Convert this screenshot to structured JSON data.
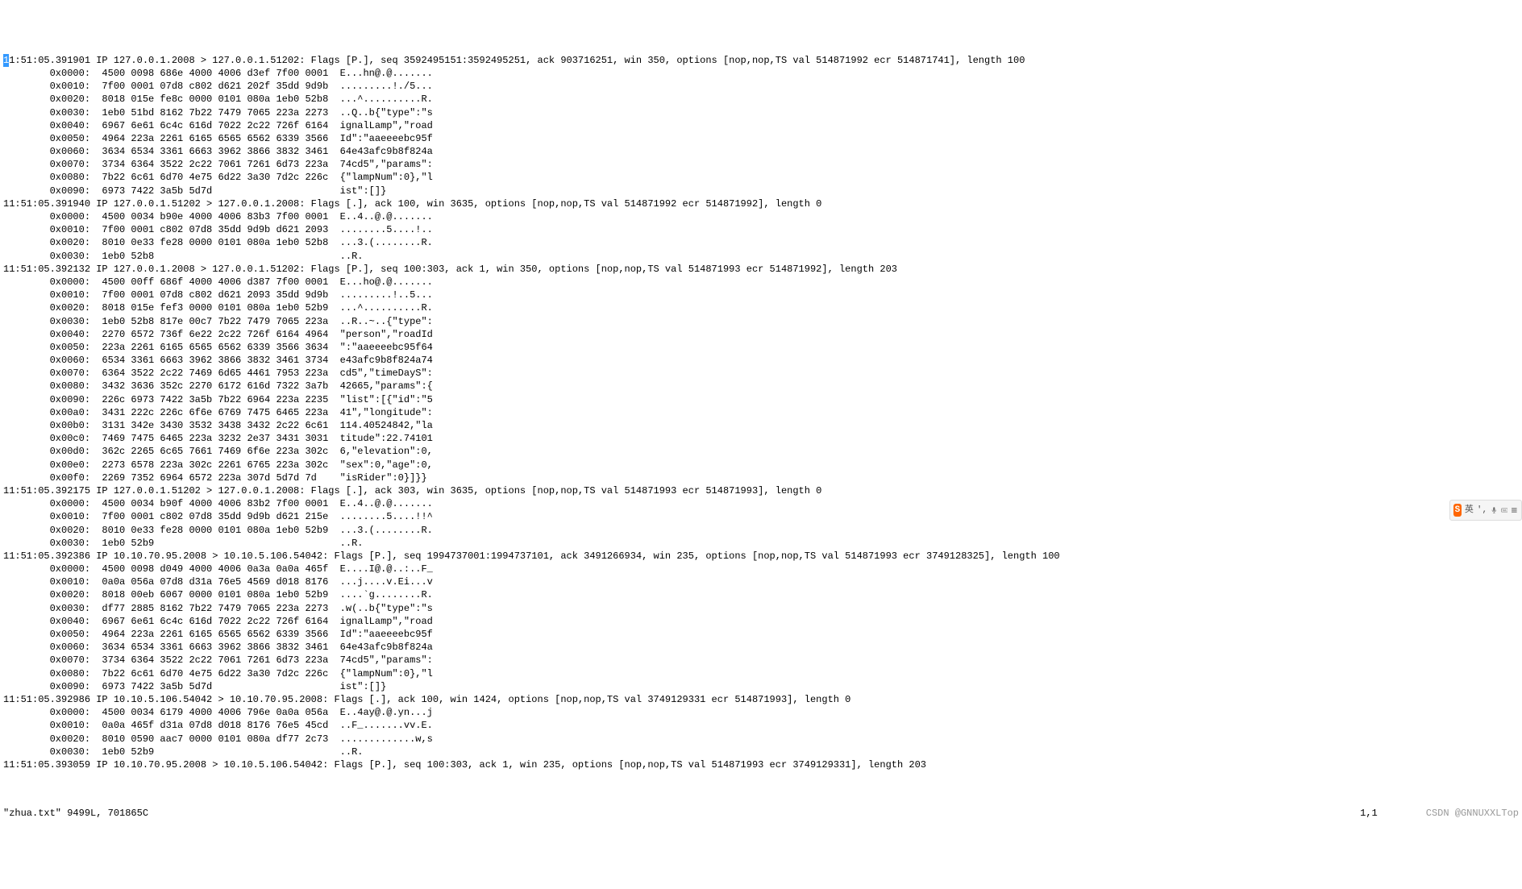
{
  "vim": {
    "cursor_char": "1",
    "status_file": "\"zhua.txt\" 9499L, 701865C",
    "status_pos": "1,1",
    "status_mode": "Top",
    "watermark": "CSDN @GNNUXXL"
  },
  "ime": {
    "logo": "S",
    "lang": "英",
    "sep": "',"
  },
  "packets": [
    {
      "header": "1:51:05.391901 IP 127.0.0.1.2008 > 127.0.0.1.51202: Flags [P.], seq 3592495151:3592495251, ack 903716251, win 350, options [nop,nop,TS val 514871992 ecr 514871741], length 100",
      "cursor_prefix": true,
      "hex": [
        "        0x0000:  4500 0098 686e 4000 4006 d3ef 7f00 0001  E...hn@.@.......",
        "        0x0010:  7f00 0001 07d8 c802 d621 202f 35dd 9d9b  .........!./5...",
        "        0x0020:  8018 015e fe8c 0000 0101 080a 1eb0 52b8  ...^..........R.",
        "        0x0030:  1eb0 51bd 8162 7b22 7479 7065 223a 2273  ..Q..b{\"type\":\"s",
        "        0x0040:  6967 6e61 6c4c 616d 7022 2c22 726f 6164  ignalLamp\",\"road",
        "        0x0050:  4964 223a 2261 6165 6565 6562 6339 3566  Id\":\"aaeeeebc95f",
        "        0x0060:  3634 6534 3361 6663 3962 3866 3832 3461  64e43afc9b8f824a",
        "        0x0070:  3734 6364 3522 2c22 7061 7261 6d73 223a  74cd5\",\"params\":",
        "        0x0080:  7b22 6c61 6d70 4e75 6d22 3a30 7d2c 226c  {\"lampNum\":0},\"l",
        "        0x0090:  6973 7422 3a5b 5d7d                      ist\":[]}"
      ]
    },
    {
      "header": "11:51:05.391940 IP 127.0.0.1.51202 > 127.0.0.1.2008: Flags [.], ack 100, win 3635, options [nop,nop,TS val 514871992 ecr 514871992], length 0",
      "hex": [
        "        0x0000:  4500 0034 b90e 4000 4006 83b3 7f00 0001  E..4..@.@.......",
        "        0x0010:  7f00 0001 c802 07d8 35dd 9d9b d621 2093  ........5....!..",
        "        0x0020:  8010 0e33 fe28 0000 0101 080a 1eb0 52b8  ...3.(........R.",
        "        0x0030:  1eb0 52b8                                ..R."
      ]
    },
    {
      "header": "11:51:05.392132 IP 127.0.0.1.2008 > 127.0.0.1.51202: Flags [P.], seq 100:303, ack 1, win 350, options [nop,nop,TS val 514871993 ecr 514871992], length 203",
      "hex": [
        "        0x0000:  4500 00ff 686f 4000 4006 d387 7f00 0001  E...ho@.@.......",
        "        0x0010:  7f00 0001 07d8 c802 d621 2093 35dd 9d9b  .........!..5...",
        "        0x0020:  8018 015e fef3 0000 0101 080a 1eb0 52b9  ...^..........R.",
        "        0x0030:  1eb0 52b8 817e 00c7 7b22 7479 7065 223a  ..R..~..{\"type\":",
        "        0x0040:  2270 6572 736f 6e22 2c22 726f 6164 4964  \"person\",\"roadId",
        "        0x0050:  223a 2261 6165 6565 6562 6339 3566 3634  \":\"aaeeeebc95f64",
        "        0x0060:  6534 3361 6663 3962 3866 3832 3461 3734  e43afc9b8f824a74",
        "        0x0070:  6364 3522 2c22 7469 6d65 4461 7953 223a  cd5\",\"timeDayS\":",
        "        0x0080:  3432 3636 352c 2270 6172 616d 7322 3a7b  42665,\"params\":{",
        "        0x0090:  226c 6973 7422 3a5b 7b22 6964 223a 2235  \"list\":[{\"id\":\"5",
        "        0x00a0:  3431 222c 226c 6f6e 6769 7475 6465 223a  41\",\"longitude\":",
        "        0x00b0:  3131 342e 3430 3532 3438 3432 2c22 6c61  114.40524842,\"la",
        "        0x00c0:  7469 7475 6465 223a 3232 2e37 3431 3031  titude\":22.74101",
        "        0x00d0:  362c 2265 6c65 7661 7469 6f6e 223a 302c  6,\"elevation\":0,",
        "        0x00e0:  2273 6578 223a 302c 2261 6765 223a 302c  \"sex\":0,\"age\":0,",
        "        0x00f0:  2269 7352 6964 6572 223a 307d 5d7d 7d    \"isRider\":0}]}}"
      ]
    },
    {
      "header": "11:51:05.392175 IP 127.0.0.1.51202 > 127.0.0.1.2008: Flags [.], ack 303, win 3635, options [nop,nop,TS val 514871993 ecr 514871993], length 0",
      "hex": [
        "        0x0000:  4500 0034 b90f 4000 4006 83b2 7f00 0001  E..4..@.@.......",
        "        0x0010:  7f00 0001 c802 07d8 35dd 9d9b d621 215e  ........5....!!^",
        "        0x0020:  8010 0e33 fe28 0000 0101 080a 1eb0 52b9  ...3.(........R.",
        "        0x0030:  1eb0 52b9                                ..R."
      ]
    },
    {
      "header": "11:51:05.392386 IP 10.10.70.95.2008 > 10.10.5.106.54042: Flags [P.], seq 1994737001:1994737101, ack 3491266934, win 235, options [nop,nop,TS val 514871993 ecr 3749128325], length 100",
      "hex": [
        "        0x0000:  4500 0098 d049 4000 4006 0a3a 0a0a 465f  E....I@.@..:..F_",
        "        0x0010:  0a0a 056a 07d8 d31a 76e5 4569 d018 8176  ...j....v.Ei...v",
        "        0x0020:  8018 00eb 6067 0000 0101 080a 1eb0 52b9  ....`g........R.",
        "        0x0030:  df77 2885 8162 7b22 7479 7065 223a 2273  .w(..b{\"type\":\"s",
        "        0x0040:  6967 6e61 6c4c 616d 7022 2c22 726f 6164  ignalLamp\",\"road",
        "        0x0050:  4964 223a 2261 6165 6565 6562 6339 3566  Id\":\"aaeeeebc95f",
        "        0x0060:  3634 6534 3361 6663 3962 3866 3832 3461  64e43afc9b8f824a",
        "        0x0070:  3734 6364 3522 2c22 7061 7261 6d73 223a  74cd5\",\"params\":",
        "        0x0080:  7b22 6c61 6d70 4e75 6d22 3a30 7d2c 226c  {\"lampNum\":0},\"l",
        "        0x0090:  6973 7422 3a5b 5d7d                      ist\":[]}"
      ]
    },
    {
      "header": "11:51:05.392986 IP 10.10.5.106.54042 > 10.10.70.95.2008: Flags [.], ack 100, win 1424, options [nop,nop,TS val 3749129331 ecr 514871993], length 0",
      "hex": [
        "        0x0000:  4500 0034 6179 4000 4006 796e 0a0a 056a  E..4ay@.@.yn...j",
        "        0x0010:  0a0a 465f d31a 07d8 d018 8176 76e5 45cd  ..F_.......vv.E.",
        "        0x0020:  8010 0590 aac7 0000 0101 080a df77 2c73  .............w,s",
        "        0x0030:  1eb0 52b9                                ..R."
      ]
    },
    {
      "header": "11:51:05.393059 IP 10.10.70.95.2008 > 10.10.5.106.54042: Flags [P.], seq 100:303, ack 1, win 235, options [nop,nop,TS val 514871993 ecr 3749129331], length 203",
      "hex": []
    }
  ]
}
